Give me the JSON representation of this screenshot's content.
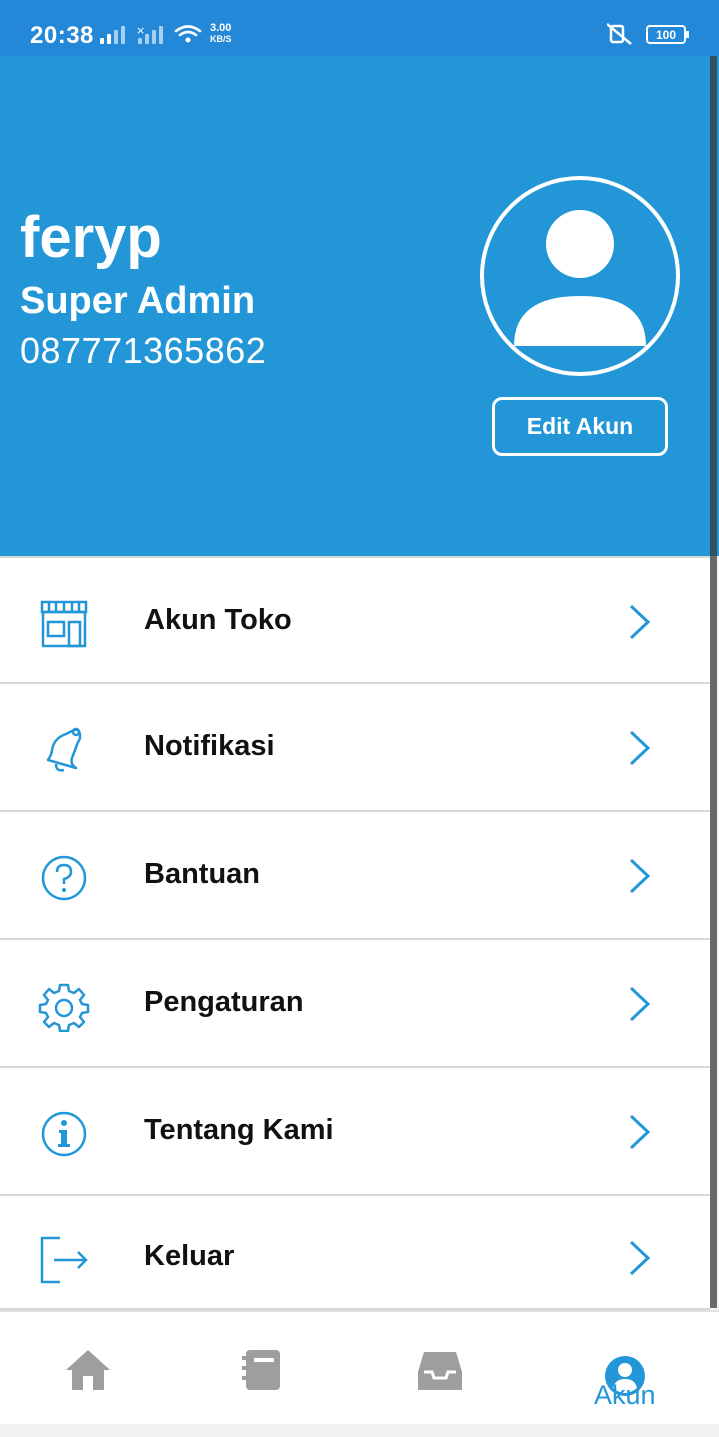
{
  "status_bar": {
    "time": "20:38",
    "speed_value": "3.00",
    "speed_unit": "KB/S",
    "battery": "100"
  },
  "profile": {
    "name": "feryp",
    "role": "Super Admin",
    "phone": "087771365862",
    "edit_button": "Edit Akun"
  },
  "menu": {
    "items": [
      {
        "label": "Akun Toko",
        "icon": "store-icon"
      },
      {
        "label": "Notifikasi",
        "icon": "bell-icon"
      },
      {
        "label": "Bantuan",
        "icon": "help-icon"
      },
      {
        "label": "Pengaturan",
        "icon": "gear-icon"
      },
      {
        "label": "Tentang Kami",
        "icon": "info-icon"
      },
      {
        "label": "Keluar",
        "icon": "logout-icon"
      }
    ]
  },
  "bottom_nav": {
    "active_label": "Akun",
    "active_color": "#2396d8",
    "inactive_color": "#9e9e9e"
  },
  "colors": {
    "header_bg": "#2396d8",
    "status_bg": "#2488d8",
    "accent": "#2396d8"
  }
}
